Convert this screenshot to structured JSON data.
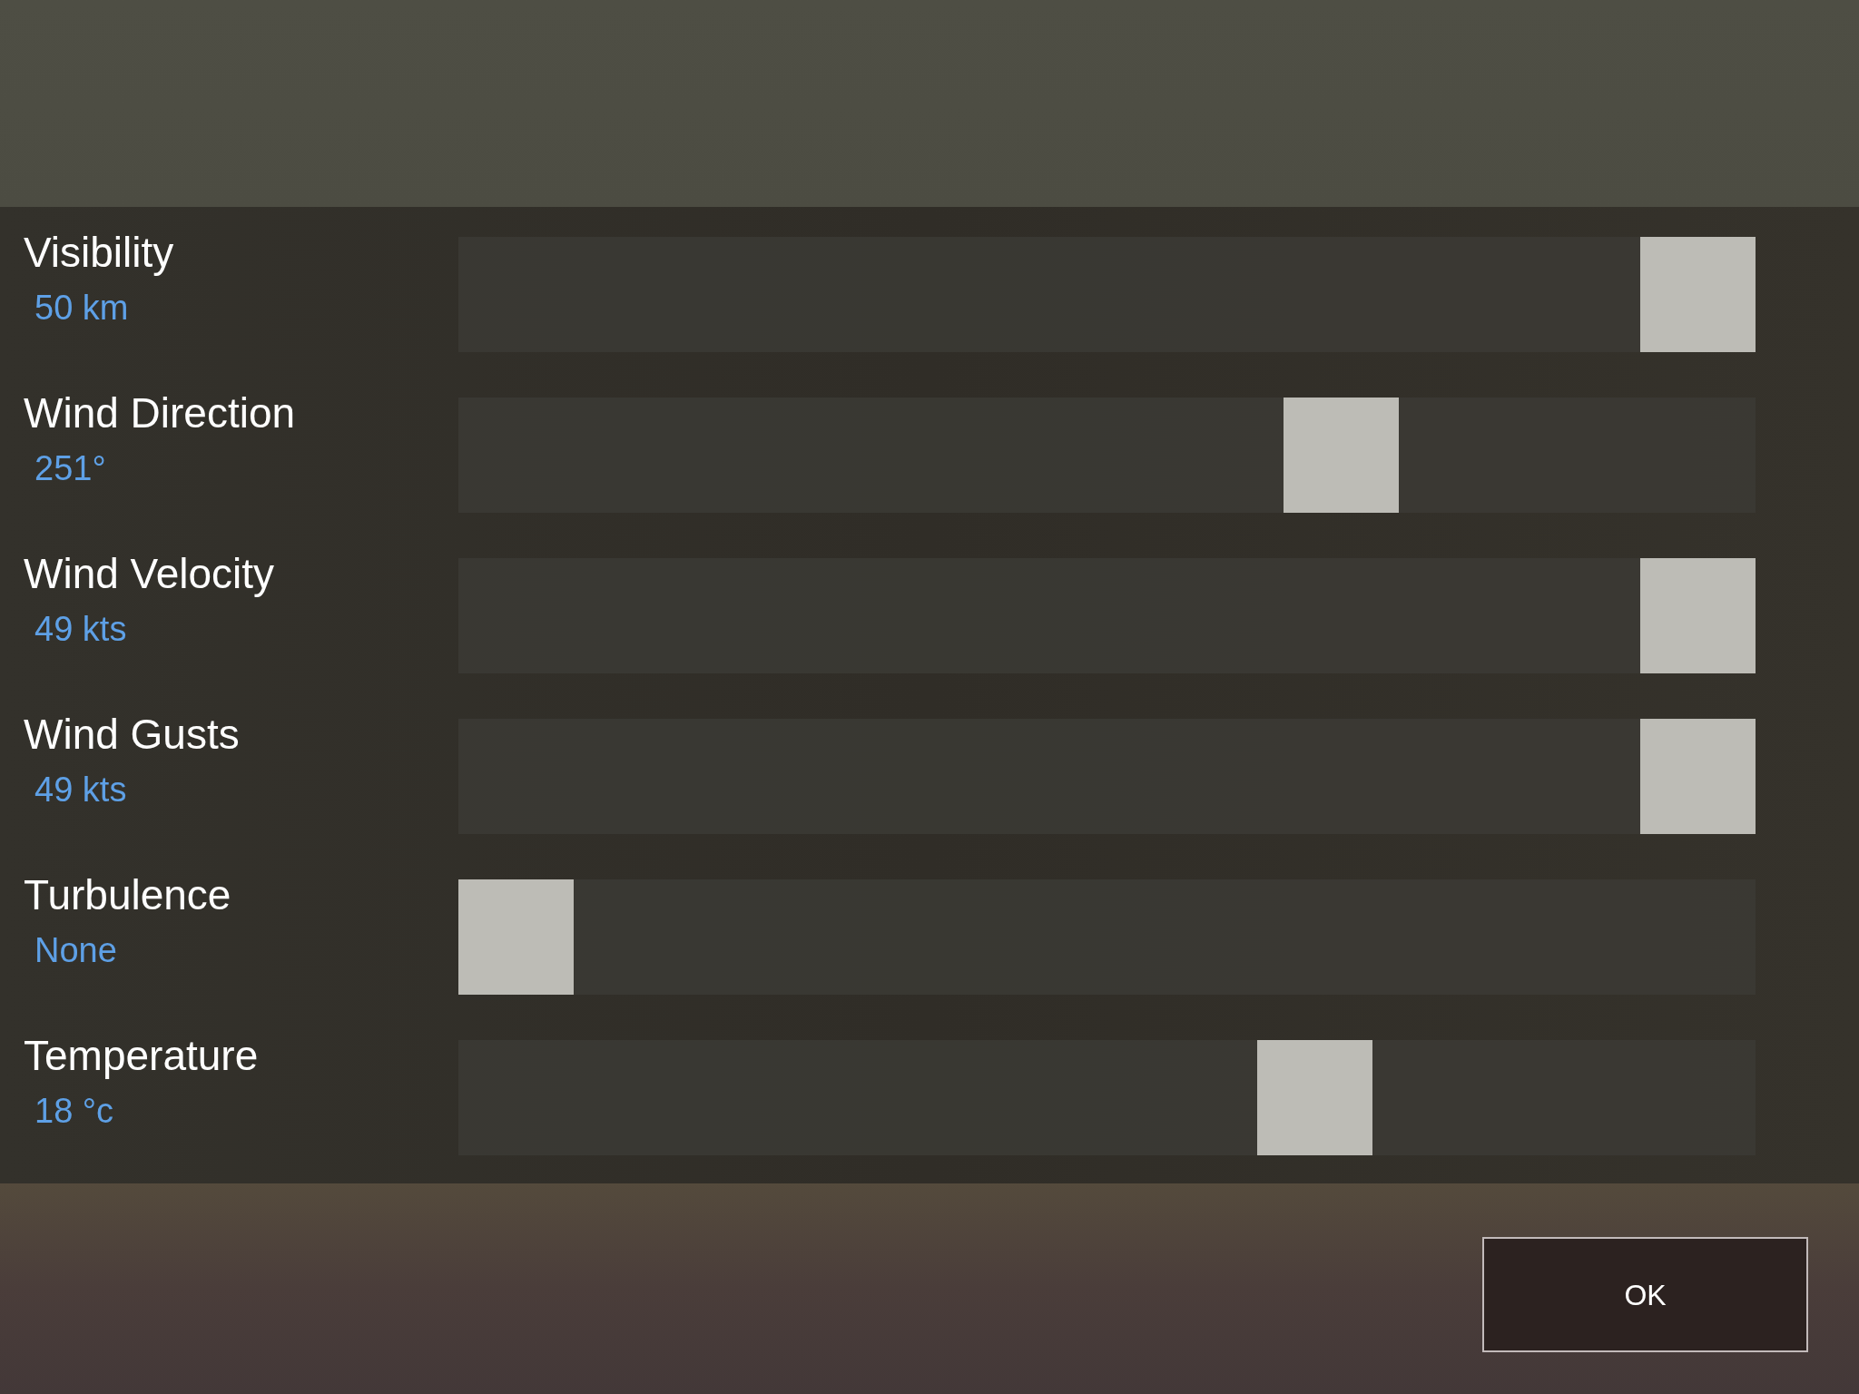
{
  "weather_settings": [
    {
      "label": "Visibility",
      "reading": "50 km",
      "level": 1
    },
    {
      "label": "Wind Direction",
      "reading": "251°",
      "level": 0.698
    },
    {
      "label": "Wind Velocity",
      "reading": "49 kts",
      "level": 1
    },
    {
      "label": "Wind Gusts",
      "reading": "49 kts",
      "level": 1
    },
    {
      "label": "Turbulence",
      "reading": "None",
      "level": 0
    },
    {
      "label": "Temperature",
      "reading": "18 °c",
      "level": 0.676
    }
  ],
  "ok_button": "OK"
}
